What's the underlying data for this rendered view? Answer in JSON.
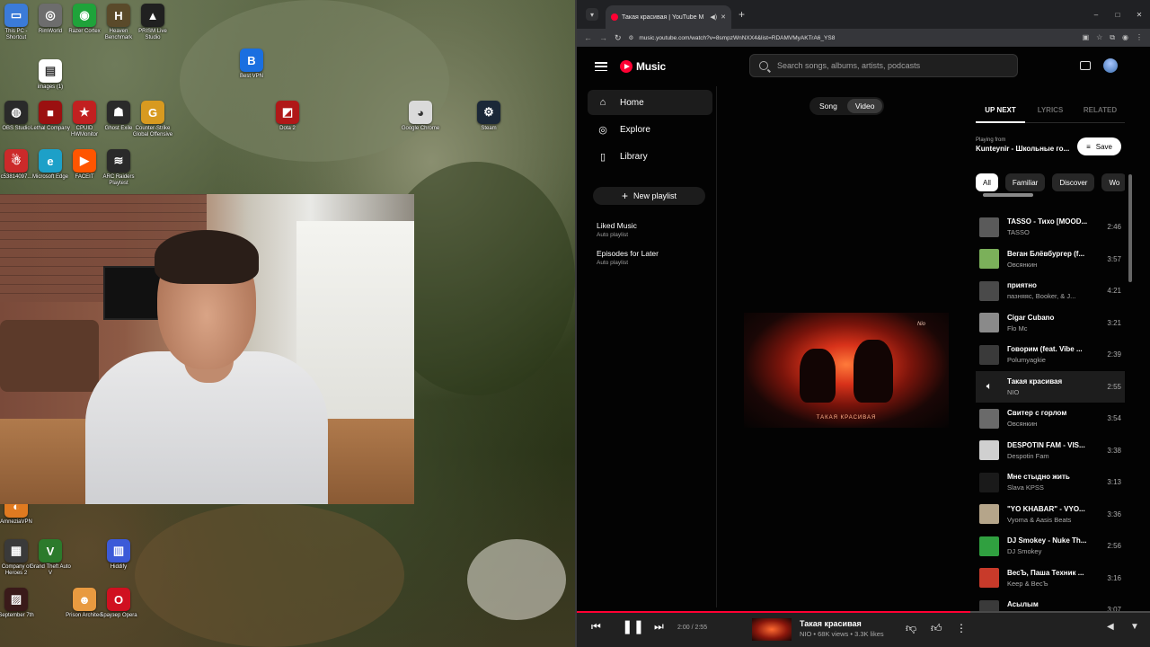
{
  "desktop": {
    "icons": [
      {
        "label": "This PC - Shortcut",
        "color": "#3b7bd8",
        "glyph": "▭"
      },
      {
        "label": "RimWorld",
        "color": "#6d6d6d",
        "glyph": "◎"
      },
      {
        "label": "Razer Cortex",
        "color": "#1fa33a",
        "glyph": "◉"
      },
      {
        "label": "Heaven Benchmark",
        "color": "#5a4a2a",
        "glyph": "H"
      },
      {
        "label": "PRISM Live Studio",
        "color": "#202020",
        "glyph": "▲"
      },
      {
        "label": "images (1)",
        "color": "#ffffff",
        "glyph": "▤"
      },
      {
        "label": "Best VPN",
        "color": "#1a6fe0",
        "glyph": "B"
      },
      {
        "label": "OBS Studio",
        "color": "#2a2a2a",
        "glyph": "◍"
      },
      {
        "label": "Lethal Company",
        "color": "#9b1010",
        "glyph": "■"
      },
      {
        "label": "CPUID HWMonitor",
        "color": "#c22020",
        "glyph": "★"
      },
      {
        "label": "Ghost Exile",
        "color": "#2a2a2a",
        "glyph": "☗"
      },
      {
        "label": "Counter-Strike Global Offensive",
        "color": "#d89a20",
        "glyph": "G"
      },
      {
        "label": "Dota 2",
        "color": "#b01818",
        "glyph": "◩"
      },
      {
        "label": "Google Chrome",
        "color": "#dadada",
        "glyph": "◕"
      },
      {
        "label": "Steam",
        "color": "#1b2838",
        "glyph": "⚙"
      },
      {
        "label": "c53814097...",
        "color": "#cc2a2a",
        "glyph": "☃"
      },
      {
        "label": "Microsoft Edge",
        "color": "#1da0c8",
        "glyph": "e"
      },
      {
        "label": "FACEIT",
        "color": "#ff5500",
        "glyph": "▶"
      },
      {
        "label": "ARC Raiders Playtest",
        "color": "#2a2a2a",
        "glyph": "≋"
      },
      {
        "label": "AmneziaVPN",
        "color": "#e07a20",
        "glyph": "◐"
      },
      {
        "label": "Company of Heroes 2",
        "color": "#3a3a3a",
        "glyph": "▦"
      },
      {
        "label": "Grand Theft Auto V",
        "color": "#2c7a2c",
        "glyph": "V"
      },
      {
        "label": "Hiddify",
        "color": "#3c5ad8",
        "glyph": "▥"
      },
      {
        "label": "September 7th",
        "color": "#3a1a1a",
        "glyph": "▨"
      },
      {
        "label": "Prison Architect",
        "color": "#e89a40",
        "glyph": "☻"
      },
      {
        "label": "Браузер Opera",
        "color": "#d01020",
        "glyph": "O"
      }
    ]
  },
  "browser": {
    "tab_title": "Такая красивая | YouTube M",
    "url": "music.youtube.com/watch?v=8smpzWnNXX4&list=RDAMVMyAKTrA6_YS8",
    "win": {
      "min": "–",
      "max": "□",
      "close": "✕"
    }
  },
  "ytm": {
    "logo_text": "Music",
    "search_placeholder": "Search songs, albums, artists, podcasts",
    "nav": [
      {
        "label": "Home",
        "icon": "home-icon",
        "glyph": "⌂"
      },
      {
        "label": "Explore",
        "icon": "compass-icon",
        "glyph": "◎"
      },
      {
        "label": "Library",
        "icon": "library-icon",
        "glyph": "▯"
      }
    ],
    "new_playlist": "New playlist",
    "playlists": [
      {
        "title": "Liked Music",
        "sub": "Auto playlist"
      },
      {
        "title": "Episodes for Later",
        "sub": "Auto playlist"
      }
    ],
    "toggle": {
      "song": "Song",
      "video": "Video"
    },
    "cover_title": "ТАКАЯ КРАСИВАЯ",
    "queue_tabs": [
      "UP NEXT",
      "LYRICS",
      "RELATED"
    ],
    "playing_from_label": "Playing from",
    "playing_from_title": "Kunteynir - Школьные го...",
    "save_label": "Save",
    "chips": [
      "All",
      "Familiar",
      "Discover",
      "Wo"
    ],
    "queue": [
      {
        "title": "TASSO - Тихо [MOOD...",
        "artist": "TASSO",
        "dur": "2:46",
        "color": "#5a5a5a"
      },
      {
        "title": "Веган Блёвбургер (f...",
        "artist": "Овсянкин",
        "dur": "3:57",
        "color": "#7bb05a"
      },
      {
        "title": "приятно",
        "artist": "пазняяс, Booker, & J...",
        "dur": "4:21",
        "color": "#4a4a4a"
      },
      {
        "title": "Cigar Cubano",
        "artist": "Flo Mc",
        "dur": "3:21",
        "color": "#8a8a8a"
      },
      {
        "title": "Говорим (feat. Vibe ...",
        "artist": "Polumyagkie",
        "dur": "2:39",
        "color": "#3a3a3a"
      },
      {
        "title": "Такая красивая",
        "artist": "NIO",
        "dur": "2:55",
        "color": "#2a2a2a"
      },
      {
        "title": "Свитер с горлом",
        "artist": "Овсянкин",
        "dur": "3:54",
        "color": "#6a6a6a"
      },
      {
        "title": "DESPOTIN FAM - VIS...",
        "artist": "Despotin Fam",
        "dur": "3:38",
        "color": "#d0d0d0"
      },
      {
        "title": "Мне стыдно жить",
        "artist": "Slava KPSS",
        "dur": "3:13",
        "color": "#1a1a1a"
      },
      {
        "title": "\"YO KHABAR\" - VYO...",
        "artist": "Vyoma & Aasis Beats",
        "dur": "3:36",
        "color": "#b5a58a"
      },
      {
        "title": "DJ Smokey - Nuke Th...",
        "artist": "DJ Smokey",
        "dur": "2:56",
        "color": "#30a040"
      },
      {
        "title": "ВесЪ, Паша Техник ...",
        "artist": "Keep & ВесЪ",
        "dur": "3:16",
        "color": "#c83a2a"
      },
      {
        "title": "Асылым",
        "artist": "AIHAN",
        "dur": "3:07",
        "color": "#3a3a3a"
      }
    ],
    "current_index": 5,
    "player": {
      "time": "2:00 / 2:55",
      "progress": 0.686,
      "title": "Такая красивая",
      "subtitle": "NIO • 68K views • 3.3K likes"
    },
    "colors": {
      "accent": "#ff0033",
      "bg": "#030303"
    }
  }
}
